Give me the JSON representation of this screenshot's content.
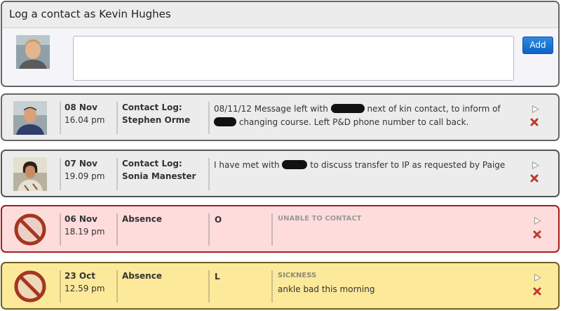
{
  "compose": {
    "title": "Log a contact as Kevin Hughes",
    "textarea_value": "",
    "add_label": "Add"
  },
  "entries": [
    {
      "kind": "contact",
      "date": "08 Nov",
      "time": "16.04 pm",
      "type": "Contact Log:",
      "author": "Stephen Orme",
      "message_parts": [
        "08/11/12 Message left with ",
        " next of kin contact, to inform of ",
        " changing course. Left P&D phone number to call back."
      ]
    },
    {
      "kind": "contact",
      "date": "07 Nov",
      "time": "19.09 pm",
      "type": "Contact Log:",
      "author": "Sonia Manester",
      "message_parts": [
        "I have met with ",
        " to discuss transfer to IP as requested by Paige"
      ]
    },
    {
      "kind": "absence",
      "date": "06 Nov",
      "time": "18.19 pm",
      "type": "Absence",
      "code": "O",
      "reason": "UNABLE TO CONTACT",
      "note": "",
      "bg": "#ffdcdc",
      "border": "#a51c1c"
    },
    {
      "kind": "absence",
      "date": "23 Oct",
      "time": "12.59 pm",
      "type": "Absence",
      "code": "L",
      "reason": "SICKNESS",
      "note": "ankle bad this morning",
      "bg": "#fce99a",
      "border": "#6e6020"
    }
  ],
  "icons": {
    "absence": "no-entry-icon",
    "expand": "play-icon",
    "delete": "delete-x-icon"
  },
  "colors": {
    "add_button": "#1a74d4",
    "delete": "#c0392b"
  }
}
